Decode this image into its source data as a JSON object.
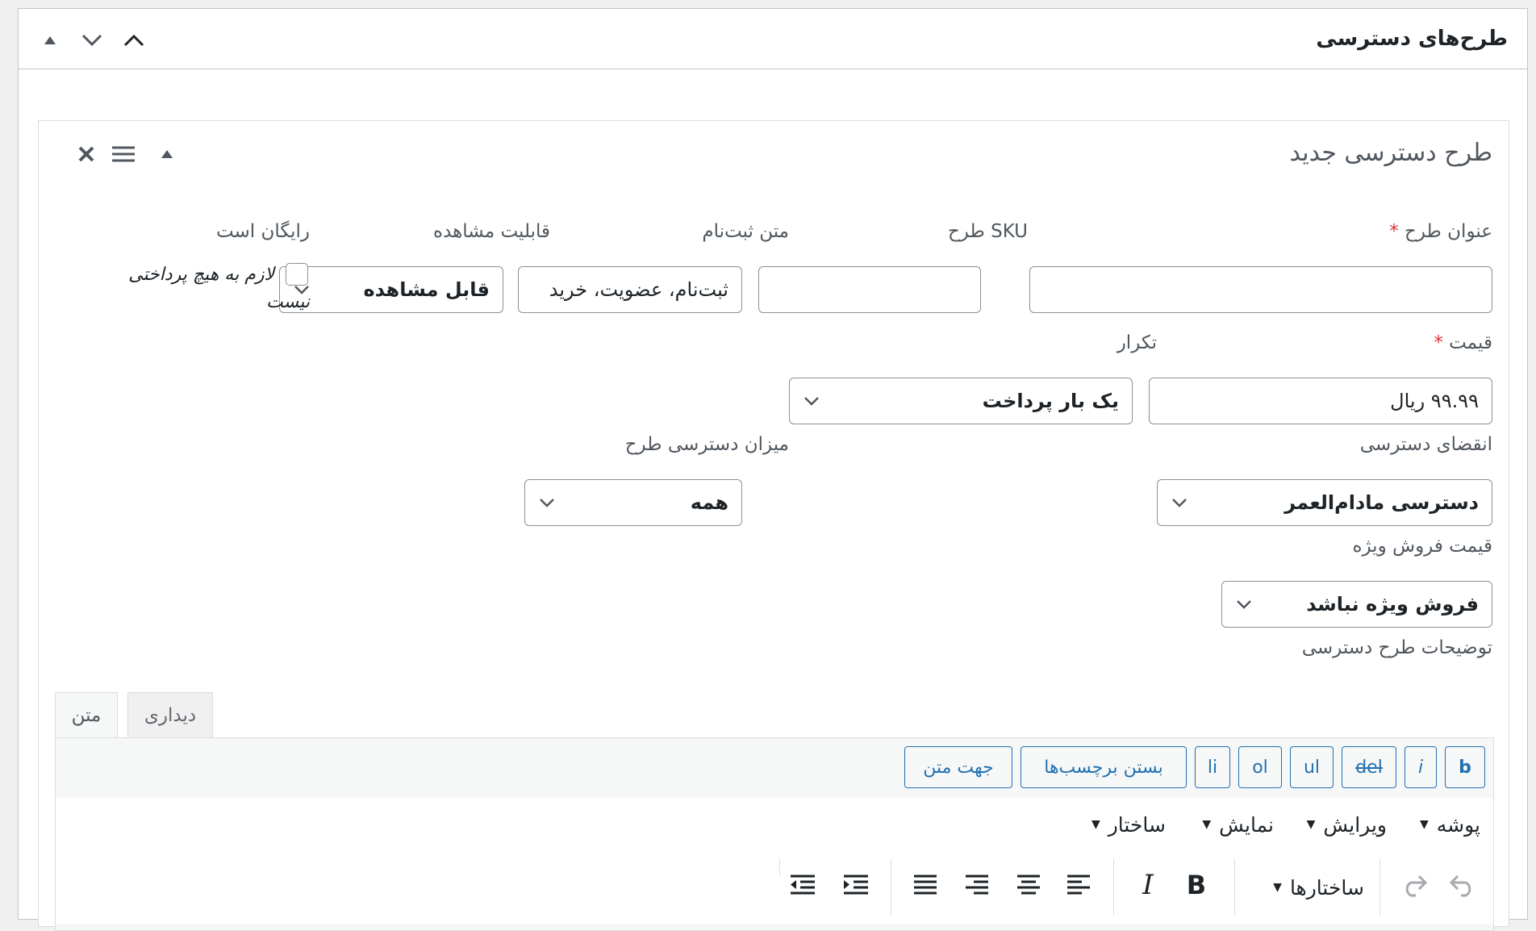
{
  "panel": {
    "title": "طرح‌های دسترسی"
  },
  "plan": {
    "title": "طرح دسترسی جدید",
    "fields": {
      "plan_title": {
        "label": "عنوان طرح",
        "required_mark": "*",
        "value": ""
      },
      "sku": {
        "label": "SKU طرح",
        "value": ""
      },
      "signup_text": {
        "label": "متن ثبت‌نام",
        "value": "ثبت‌نام، عضویت، خرید"
      },
      "visibility": {
        "label": "قابلیت مشاهده",
        "value": "قابل مشاهده"
      },
      "free": {
        "label": "رایگان است",
        "checkbox_line1": "لازم به هیچ پرداختی",
        "checkbox_line2": "نیست"
      },
      "price": {
        "label": "قیمت",
        "required_mark": "*",
        "value": "۹۹.۹۹ ریال"
      },
      "recurrence": {
        "label": "تکرار",
        "value": "یک بار پرداخت"
      },
      "expiry": {
        "label": "انقضای دسترسی",
        "value": "دسترسی مادام‌العمر"
      },
      "access_level": {
        "label": "میزان دسترسی طرح",
        "value": "همه"
      },
      "sale_price": {
        "label": "قیمت فروش ویژه",
        "value": "فروش ویژه نباشد"
      },
      "description": {
        "label": "توضیحات طرح دسترسی"
      }
    },
    "editor": {
      "tabs": {
        "text": "متن",
        "visual": "دیداری"
      },
      "quicktags": [
        "b",
        "i",
        "del",
        "ul",
        "ol",
        "li",
        "بستن برچسب‌ها",
        "جهت متن"
      ],
      "menus": [
        "پوشه",
        "ویرایش",
        "نمایش",
        "ساختار"
      ],
      "formats_label": "ساختارها"
    }
  }
}
